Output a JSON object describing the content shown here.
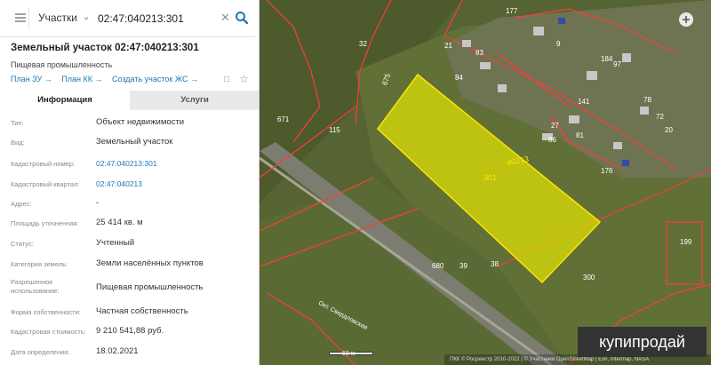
{
  "search": {
    "type": "Участки",
    "value": "02:47:040213:301"
  },
  "header": {
    "title": "Земельный участок 02:47:040213:301",
    "subtitle": "Пищевая промышленность",
    "links": [
      "План ЗУ →",
      "План КК →",
      "Создать участок ЖС →"
    ]
  },
  "tabs": [
    {
      "label": "Информация"
    },
    {
      "label": "Услуги"
    }
  ],
  "attributes": [
    {
      "label": "Тип:",
      "value": "Объект недвижимости"
    },
    {
      "label": "Вид:",
      "value": "Земельный участок"
    },
    {
      "label": "Кадастровый номер:",
      "value": "02:47:040213:301"
    },
    {
      "label": "Кадастровый квартал:",
      "value": "02:47:040213"
    },
    {
      "label": "Адрес:",
      "value": "-"
    },
    {
      "label": "Площадь уточненная:",
      "value": "25 414 кв. м"
    },
    {
      "label": "Статус:",
      "value": "Учтенный"
    },
    {
      "label": "Категория земель:",
      "value": "Земли населённых пунктов"
    },
    {
      "label": "Разрешенное использование:",
      "value": "Пищевая промышленность"
    },
    {
      "label": "Форма собственности:",
      "value": "Частная собственность"
    },
    {
      "label": "Кадастровая стоимость:",
      "value": "9 210 541,88 руб."
    },
    {
      "label": "Дата определения:",
      "value": "18.02.2021"
    }
  ],
  "map": {
    "lot_labels": [
      "32",
      "21",
      "83",
      "675",
      "115",
      "671",
      "40213",
      "301",
      "84",
      "184",
      "97",
      "177",
      "81",
      "78",
      "72",
      "20",
      "176",
      "199",
      "300",
      "38",
      "39",
      "680",
      "9",
      "86",
      "27",
      "141"
    ],
    "street": "Окт. Свердловская",
    "scale": "60 м",
    "attribution": "ПКК © Росреестр 2010-2022 | © Участники OpenStreetMap | Esri, Intermap, NASA",
    "watermark": "купипродай"
  },
  "colors": {
    "accent": "#1f78b4",
    "search_button": "#1f78b4",
    "selected_parcel": "#e6e600",
    "boundary": "#ff3b3b"
  }
}
